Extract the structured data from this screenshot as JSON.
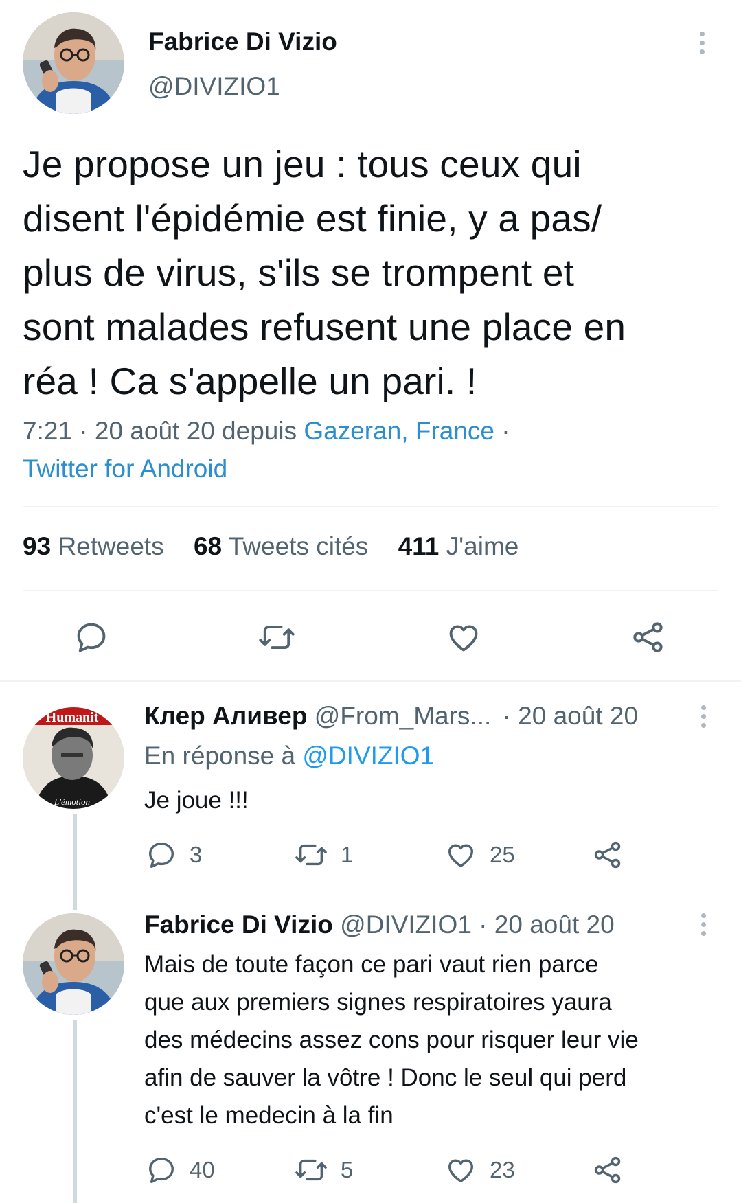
{
  "main_tweet": {
    "author_name": "Fabrice Di Vizio",
    "author_handle": "@DIVIZIO1",
    "text_lines": [
      "Je propose un jeu : tous ceux qui",
      "disent l'épidémie est finie, y a pas/",
      "plus de virus, s'ils se trompent et",
      "sont malades refusent une place en",
      "réa ! Ca s'appelle un pari. !"
    ],
    "time": "7:21 · 20 août 20 depuis ",
    "location": "Gazeran, France",
    "sep": " ·",
    "source": "Twitter for Android",
    "stats": {
      "retweets_count": "93",
      "retweets_label": "Retweets",
      "quotes_count": "68",
      "quotes_label": "Tweets cités",
      "likes_count": "411",
      "likes_label": "J'aime"
    },
    "icons": [
      "reply-icon",
      "retweet-icon",
      "like-icon",
      "share-icon"
    ]
  },
  "replies": [
    {
      "author_name": "Клер Аливер",
      "author_handle": "@From_Mars...",
      "date": " · 20 août 20",
      "reply_to_prefix": "En réponse à ",
      "reply_to_handle": "@DIVIZIO1",
      "text_lines": [
        "Je joue !!!"
      ],
      "avatar_text_top": "Humanit",
      "avatar_text_bottom": "L'émotion",
      "reply_count": "3",
      "retweet_count": "1",
      "like_count": "25"
    },
    {
      "author_name": "Fabrice Di Vizio",
      "author_handle": "@DIVIZIO1",
      "date": " · 20 août 20",
      "text_lines": [
        "Mais de toute façon ce pari vaut rien parce",
        "que aux premiers signes respiratoires yaura",
        "des médecins assez cons pour risquer leur vie",
        "afin de sauver la vôtre ! Donc le seul qui perd",
        "c'est le medecin à la fin"
      ],
      "reply_count": "40",
      "retweet_count": "5",
      "like_count": "23"
    }
  ],
  "colors": {
    "text_primary": "#0f1419",
    "text_secondary": "#536471",
    "link": "#1d9bf0",
    "divider": "#eff3f4",
    "thread_line": "#cfd9de"
  }
}
